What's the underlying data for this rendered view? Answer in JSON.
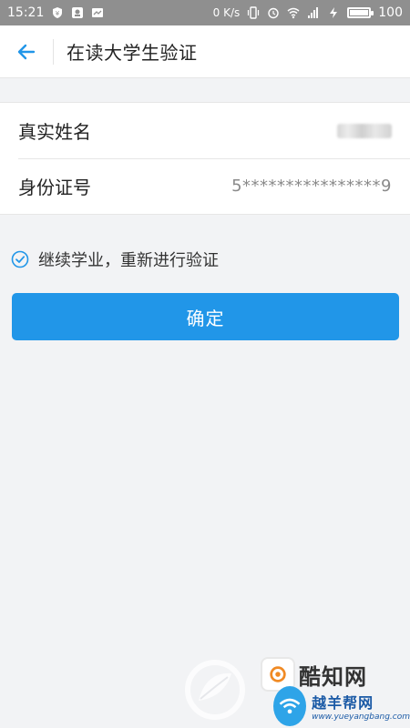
{
  "status_bar": {
    "time": "15:21",
    "net_speed": "0 K/s",
    "battery": "100",
    "battery_level": 100,
    "icons": [
      "shield-icon",
      "notification-icon",
      "message-icon",
      "vibrate-icon",
      "alarm-icon",
      "wifi-icon",
      "signal-icon",
      "charging-icon",
      "battery-icon"
    ]
  },
  "header": {
    "back_icon": "arrow-left-icon",
    "title": "在读大学生验证"
  },
  "form": {
    "rows": [
      {
        "label": "真实姓名",
        "value": ""
      },
      {
        "label": "身份证号",
        "value": "5****************9"
      }
    ]
  },
  "checkbox": {
    "checked": true,
    "label": "继续学业，重新进行验证"
  },
  "confirm_button": {
    "label": "确定"
  },
  "watermarks": {
    "cool_site": "酷知网",
    "right_site_cn": "越羊帮网",
    "right_site_en": "www.yueyangbang.com"
  },
  "colors": {
    "accent": "#2196e8",
    "status_bar": "#8f8f8f",
    "background": "#f2f3f5"
  }
}
